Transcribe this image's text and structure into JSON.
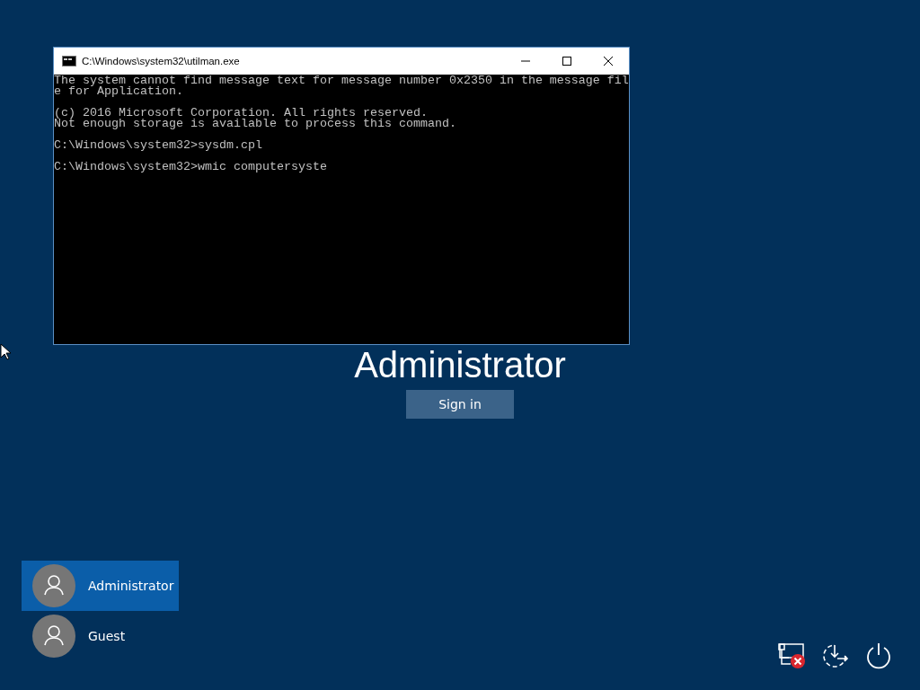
{
  "console_window": {
    "title": "C:\\Windows\\system32\\utilman.exe",
    "blocks": [
      [
        "The system cannot find message text for message number 0x2350 in the message fil",
        "e for Application."
      ],
      [
        "(c) 2016 Microsoft Corporation. All rights reserved.",
        "Not enough storage is available to process this command."
      ],
      [
        "C:\\Windows\\system32>sysdm.cpl"
      ],
      [
        "C:\\Windows\\system32>wmic computersyste"
      ]
    ]
  },
  "user_name": "Administrator",
  "sign_in_button": "Sign in",
  "users": [
    {
      "name": "Administrator",
      "selected": true
    },
    {
      "name": "Guest",
      "selected": false
    }
  ],
  "network_disconnected": true
}
